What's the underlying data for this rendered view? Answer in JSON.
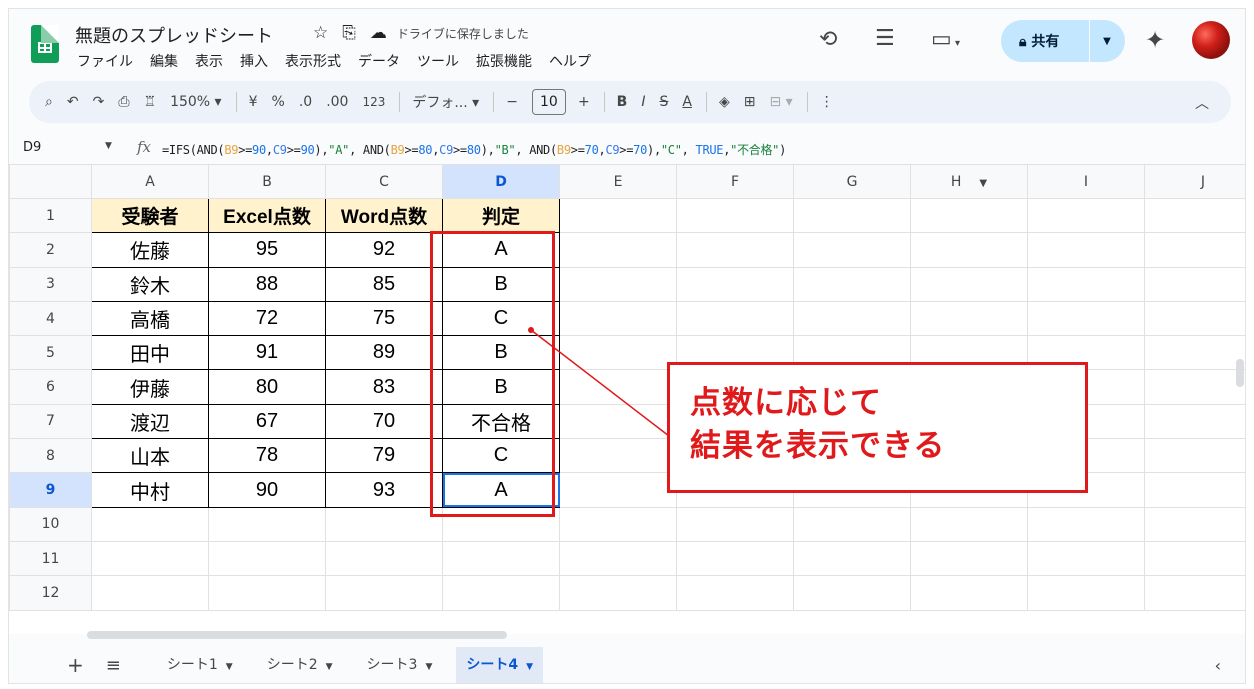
{
  "doc": {
    "title": "無題のスプレッドシート",
    "saved_status": "ドライブに保存しました"
  },
  "menu": [
    "ファイル",
    "編集",
    "表示",
    "挿入",
    "表示形式",
    "データ",
    "ツール",
    "拡張機能",
    "ヘルプ"
  ],
  "share": {
    "label": "共有"
  },
  "toolbar": {
    "zoom": "150%",
    "currency": "¥",
    "percent": "%",
    "dec_decrease": ".0",
    "dec_increase": ".00",
    "number_format": "123",
    "font": "デフォ...",
    "font_size": "10",
    "bold": "B",
    "italic": "I",
    "strike": "S",
    "text_color": "A"
  },
  "formula_bar": {
    "cell_ref": "D9",
    "fx": "fx",
    "formula": "=IFS(AND(B9>=90,C9>=90),\"A\", AND(B9>=80,C9>=80),\"B\", AND(B9>=70,C9>=70),\"C\", TRUE,\"不合格\")"
  },
  "columns": [
    "A",
    "B",
    "C",
    "D",
    "E",
    "F",
    "G",
    "H",
    "I",
    "J"
  ],
  "row_numbers": [
    "1",
    "2",
    "3",
    "4",
    "5",
    "6",
    "7",
    "8",
    "9",
    "10",
    "11",
    "12"
  ],
  "table": {
    "headers": [
      "受験者",
      "Excel点数",
      "Word点数",
      "判定"
    ],
    "rows": [
      [
        "佐藤",
        "95",
        "92",
        "A"
      ],
      [
        "鈴木",
        "88",
        "85",
        "B"
      ],
      [
        "高橋",
        "72",
        "75",
        "C"
      ],
      [
        "田中",
        "91",
        "89",
        "B"
      ],
      [
        "伊藤",
        "80",
        "83",
        "B"
      ],
      [
        "渡辺",
        "67",
        "70",
        "不合格"
      ],
      [
        "山本",
        "78",
        "79",
        "C"
      ],
      [
        "中村",
        "90",
        "93",
        "A"
      ]
    ]
  },
  "callout": {
    "line1": "点数に応じて",
    "line2": "結果を表示できる"
  },
  "sheets": [
    "シート1",
    "シート2",
    "シート3",
    "シート4"
  ],
  "active_sheet": "シート4",
  "colors": {
    "accent_red": "#e0191b",
    "header_fill": "#fff2cc",
    "selection_blue": "#1a73e8",
    "share_bg": "#c2e7ff"
  }
}
